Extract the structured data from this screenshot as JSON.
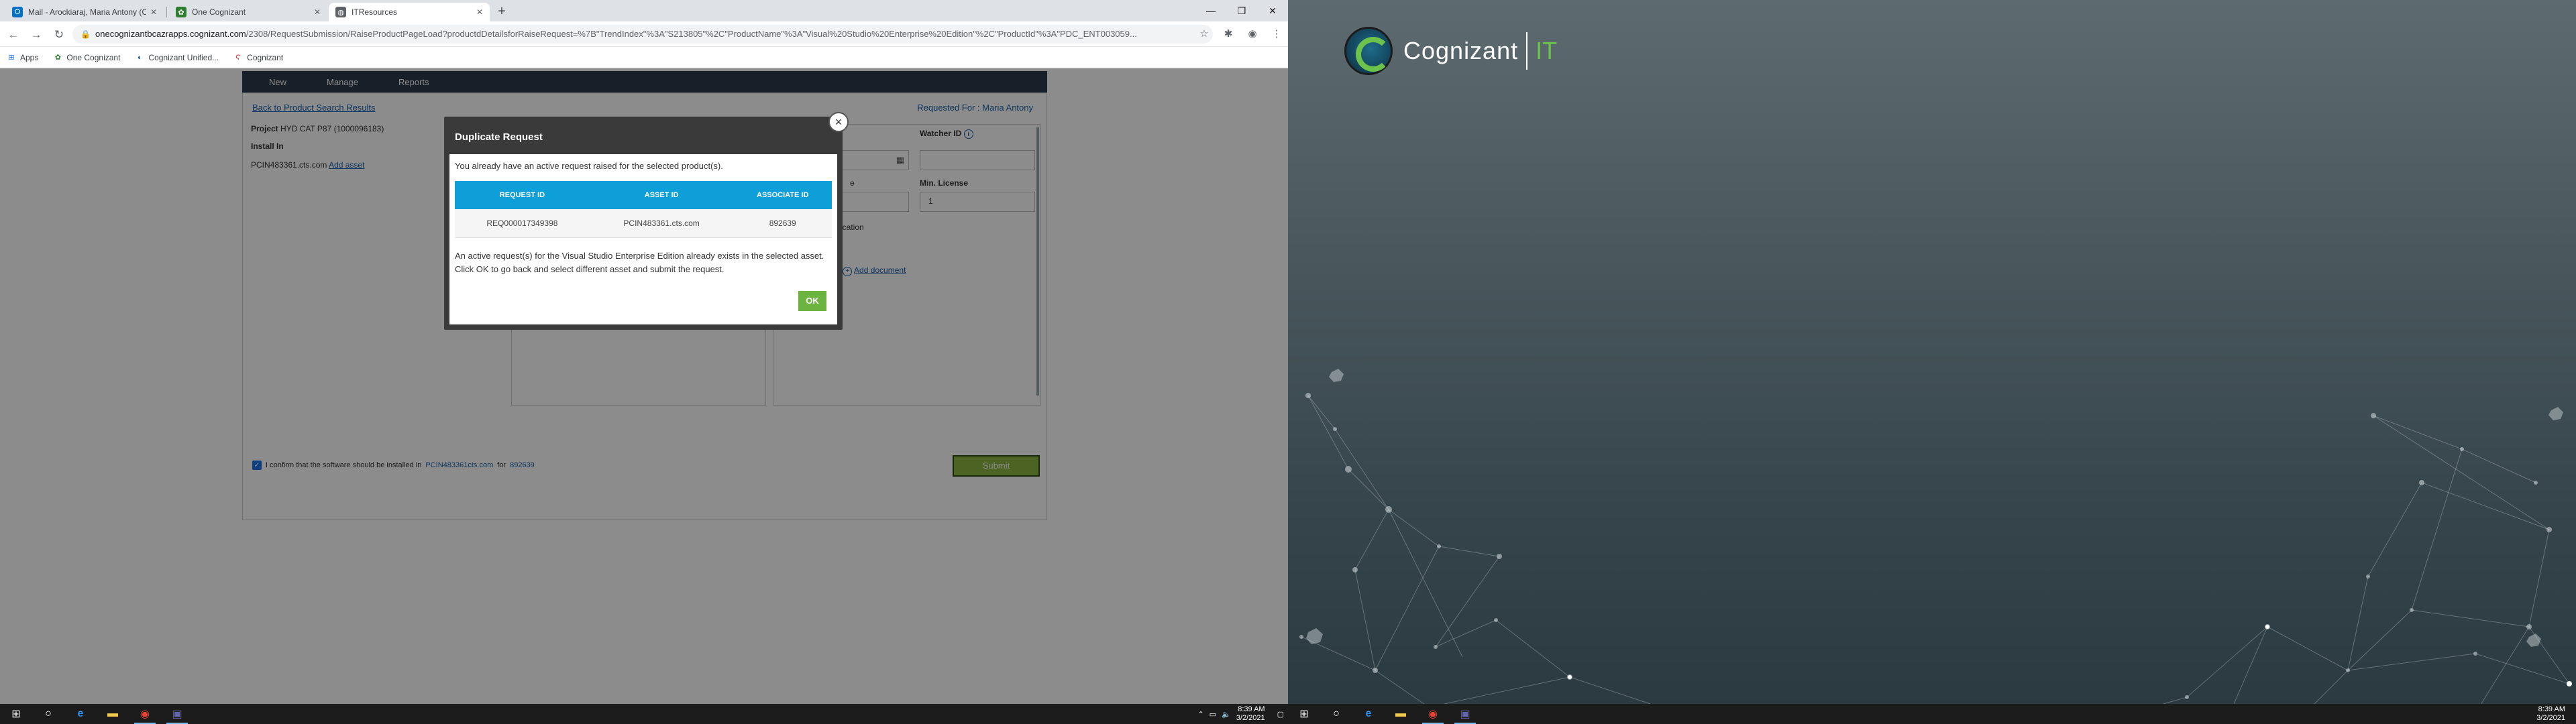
{
  "browser": {
    "tabs": [
      {
        "label": "Mail - Arockiaraj, Maria Antony (Cognizant)",
        "icon_name": "outlook-icon",
        "color": "#0072c6"
      },
      {
        "label": "One Cognizant",
        "icon_name": "one-cognizant-icon",
        "color": "#2e7d32"
      },
      {
        "label": "ITResources",
        "icon_name": "globe-icon",
        "color": "#5f6368"
      }
    ],
    "url_host": "onecognizantbcazrapps.cognizant.com",
    "url_path": "/2308/RequestSubmission/RaiseProductPageLoad?productdDetailsforRaiseRequest=%7B\"TrendIndex\"%3A\"S213805\"%2C\"ProductName\"%3A\"Visual%20Studio%20Enterprise%20Edition\"%2C\"ProductId\"%3A\"PDC_ENT003059...",
    "bookmarks": [
      {
        "label": "Apps",
        "icon": "⊞"
      },
      {
        "label": "One Cognizant",
        "icon": "✿"
      },
      {
        "label": "Cognizant Unified...",
        "icon": "◐"
      },
      {
        "label": "Cognizant",
        "icon": "Ϛ"
      }
    ]
  },
  "app": {
    "nav": [
      "New",
      "Manage",
      "Reports"
    ],
    "back_link": "Back to Product Search Results",
    "requested_for": "Requested For : Maria Antony",
    "project_label": "Project",
    "project_value": "HYD CAT P87 (1000096183)",
    "install_in_label": "Install In",
    "install_value": "PCIN483361.cts.com",
    "add_asset": "Add asset",
    "watcher_id_label": "Watcher ID",
    "min_license_label": "Min. License",
    "min_license_value": "1",
    "justification_partial": "ication",
    "attach_partial": "ss",
    "add_document": "Add document",
    "confirm_text": "I confirm that the software should be installed in",
    "confirm_asset": "PCIN483361cts.com",
    "confirm_for": "for",
    "confirm_id": "892639",
    "submit_label": "Submit",
    "partial_label": "e"
  },
  "modal": {
    "title": "Duplicate Request",
    "message": "You already have an active request raised for the selected product(s).",
    "columns": [
      "REQUEST ID",
      "ASSET ID",
      "ASSOCIATE ID"
    ],
    "rows": [
      [
        "REQ000017349398",
        "PCIN483361.cts.com",
        "892639"
      ]
    ],
    "note": "An active request(s) for the Visual Studio Enterprise Edition already exists in the selected asset. Click OK to go back and select different asset and submit the request.",
    "ok_label": "OK",
    "close_label": "×"
  },
  "taskbar": {
    "time": "8:39 AM",
    "date": "3/2/2021"
  },
  "desktop2": {
    "logo_word": "Cognizant",
    "logo_suffix": "IT",
    "time": "8:39 AM",
    "date": "3/2/2021"
  },
  "colors": {
    "nav_bg": "#2a3a4a",
    "table_header": "#0e9fd8",
    "ok_button": "#6db33f",
    "brand_green": "#6cc24a"
  }
}
